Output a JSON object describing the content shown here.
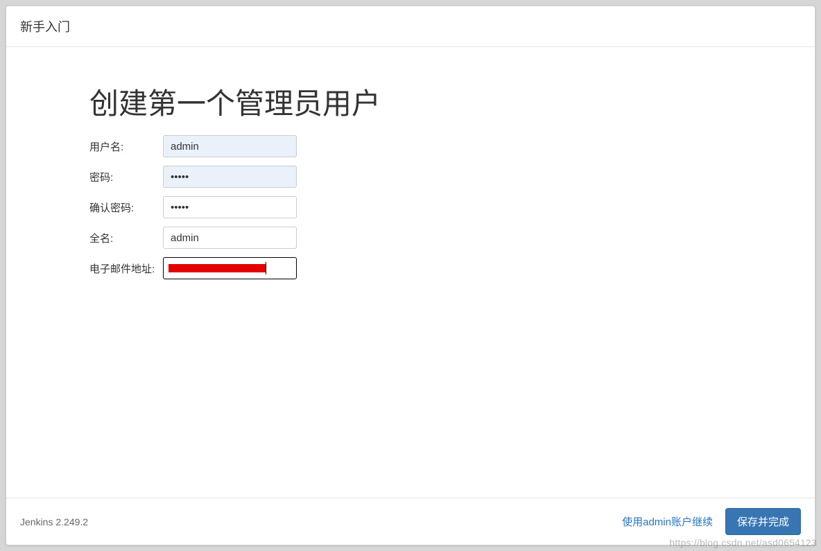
{
  "header": {
    "title": "新手入门"
  },
  "main": {
    "heading": "创建第一个管理员用户",
    "fields": {
      "username": {
        "label": "用户名:",
        "value": "admin"
      },
      "password": {
        "label": "密码:",
        "value": "•••••"
      },
      "confirm": {
        "label": "确认密码:",
        "value": "•••••"
      },
      "fullname": {
        "label": "全名:",
        "value": "admin"
      },
      "email": {
        "label": "电子邮件地址:",
        "value": ""
      }
    }
  },
  "footer": {
    "version": "Jenkins 2.249.2",
    "continue_as_admin": "使用admin账户继续",
    "save_and_finish": "保存并完成"
  },
  "watermark": "https://blog.csdn.net/asd0654123"
}
